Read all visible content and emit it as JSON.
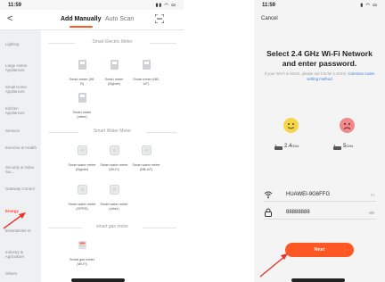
{
  "left": {
    "status": {
      "time": "11:59"
    },
    "nav": {
      "back": "<",
      "tab_manual": "Add Manually",
      "tab_auto": "Auto Scan"
    },
    "sidebar": [
      {
        "label": "Lighting"
      },
      {
        "label": "Large Home Appliances"
      },
      {
        "label": "Small Home Appliances"
      },
      {
        "label": "Kitchen Appliances"
      },
      {
        "label": "Sensors"
      },
      {
        "label": "Exercise & Health"
      },
      {
        "label": "Security & Video Sur..."
      },
      {
        "label": "Gateway Control"
      },
      {
        "label": "Energy",
        "selected": true
      },
      {
        "label": "Entertainme nt"
      },
      {
        "label": "Industry & Agriculture"
      },
      {
        "label": "Others"
      }
    ],
    "sections": [
      {
        "title": "Smart Electric Meter"
      },
      {
        "title": "Smart Water Meter"
      },
      {
        "title": "smart gas meter"
      }
    ],
    "electric": [
      {
        "label": "Smart meter (Wi-Fi)"
      },
      {
        "label": "Smart meter (Zigbee)"
      },
      {
        "label": "Smart meter (NB-IoT)"
      },
      {
        "label": "Smart meter (other)"
      }
    ],
    "water": [
      {
        "label": "Smart water meter (Zigbee)"
      },
      {
        "label": "Smart water meter (Wi-Fi)"
      },
      {
        "label": "Smart water meter (NB-IoT)"
      },
      {
        "label": "Smart water meter (GPRS)"
      },
      {
        "label": "Smart water meter (other)"
      }
    ],
    "gas": [
      {
        "label": "Smart gas meter (Wi-Fi)"
      }
    ]
  },
  "right": {
    "status": {
      "time": "11:59"
    },
    "cancel": "Cancel",
    "title": "Select 2.4 GHz Wi-Fi Network and enter password.",
    "subtitle": "If your Wi-Fi is 5GHz, please set it to be 2.4GHz.",
    "subtitle_link": "Common router setting method",
    "band_ok": "2.4",
    "band_ok_unit": "GHz",
    "band_bad": "5",
    "band_bad_unit": "GHz",
    "wifi_name": "HUAWEI-9G6FFG",
    "wifi_trail": "Re",
    "password": "88888888",
    "next": "Next"
  },
  "colors": {
    "accent": "#ff5722",
    "selected": "#ff4a3a",
    "link": "#3a7bdc",
    "happy": "#f6d54a",
    "sad": "#f08a8a"
  }
}
